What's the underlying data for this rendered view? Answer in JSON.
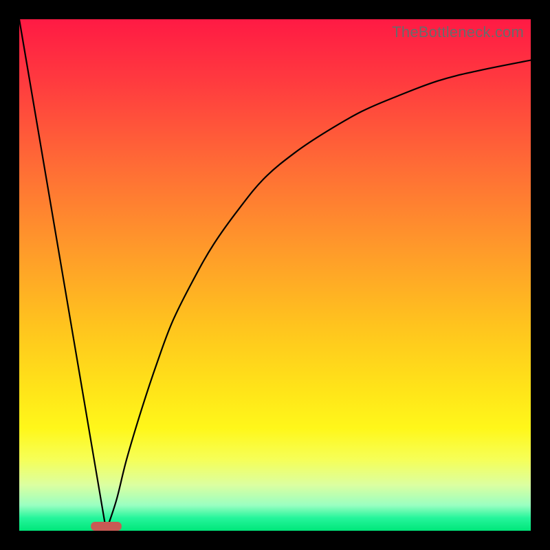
{
  "watermark": "TheBottleneck.com",
  "colors": {
    "frame": "#000000",
    "curve": "#000000",
    "marker_fill": "#c85a54",
    "gradient_stops": [
      {
        "offset": 0.0,
        "color": "#ff1a44"
      },
      {
        "offset": 0.12,
        "color": "#ff3a3f"
      },
      {
        "offset": 0.28,
        "color": "#ff6a36"
      },
      {
        "offset": 0.45,
        "color": "#ff9a2a"
      },
      {
        "offset": 0.6,
        "color": "#ffc41e"
      },
      {
        "offset": 0.72,
        "color": "#ffe319"
      },
      {
        "offset": 0.8,
        "color": "#fff71a"
      },
      {
        "offset": 0.86,
        "color": "#f6ff57"
      },
      {
        "offset": 0.91,
        "color": "#dcffa0"
      },
      {
        "offset": 0.95,
        "color": "#9affc1"
      },
      {
        "offset": 0.975,
        "color": "#25f59b"
      },
      {
        "offset": 1.0,
        "color": "#00e67a"
      }
    ]
  },
  "chart_data": {
    "type": "line",
    "title": "",
    "xlabel": "",
    "ylabel": "",
    "xlim": [
      0,
      100
    ],
    "ylim": [
      0,
      100
    ],
    "grid": false,
    "legend": "none",
    "annotations": [
      "TheBottleneck.com"
    ],
    "series": [
      {
        "name": "left-slope",
        "x": [
          0,
          17
        ],
        "y": [
          100,
          0
        ]
      },
      {
        "name": "right-curve",
        "x": [
          17,
          19,
          21,
          24,
          27,
          30,
          34,
          38,
          43,
          48,
          54,
          60,
          67,
          74,
          82,
          90,
          100
        ],
        "y": [
          0,
          6,
          14,
          24,
          33,
          41,
          49,
          56,
          63,
          69,
          74,
          78,
          82,
          85,
          88,
          90,
          92
        ]
      }
    ],
    "marker": {
      "name": "minimum",
      "shape": "rounded-bar",
      "x_center": 17,
      "x_halfwidth": 3,
      "y": 0
    }
  }
}
